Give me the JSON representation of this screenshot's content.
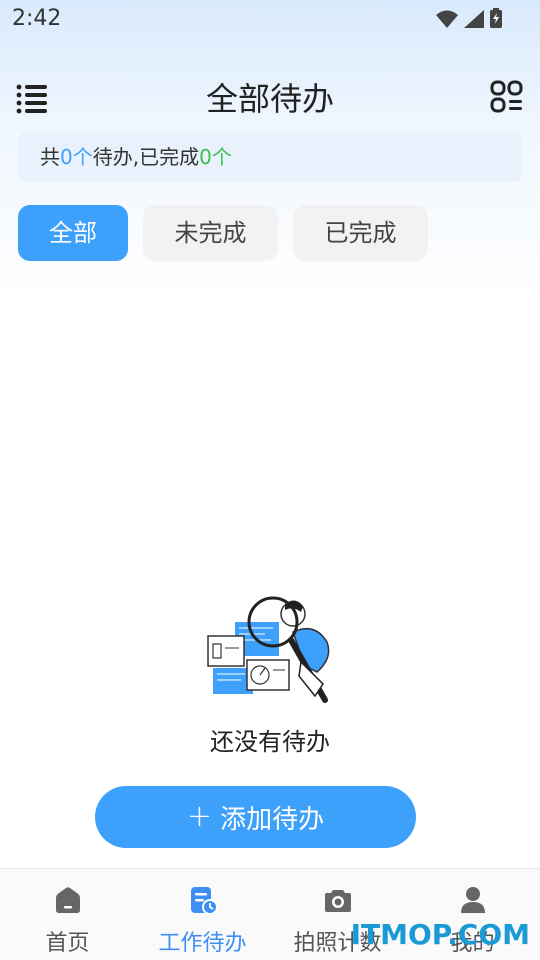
{
  "status_bar": {
    "time": "2:42"
  },
  "header": {
    "title": "全部待办"
  },
  "summary": {
    "prefix": "共",
    "total": "0个",
    "middle": "待办,已完成",
    "completed": "0个"
  },
  "tabs": [
    {
      "label": "全部",
      "active": true
    },
    {
      "label": "未完成",
      "active": false
    },
    {
      "label": "已完成",
      "active": false
    }
  ],
  "empty_state": {
    "message": "还没有待办"
  },
  "add_button": {
    "icon": "+",
    "label": "添加待办"
  },
  "bottom_nav": [
    {
      "label": "首页",
      "icon": "home-icon",
      "active": false
    },
    {
      "label": "工作待办",
      "icon": "todo-icon",
      "active": true
    },
    {
      "label": "拍照计数",
      "icon": "camera-icon",
      "active": false
    },
    {
      "label": "我的",
      "icon": "user-icon",
      "active": false
    }
  ],
  "watermark": "ITMOP.COM",
  "colors": {
    "accent": "#3da0fa",
    "completed_green": "#37c24a",
    "nav_active": "#3d8ff5"
  }
}
